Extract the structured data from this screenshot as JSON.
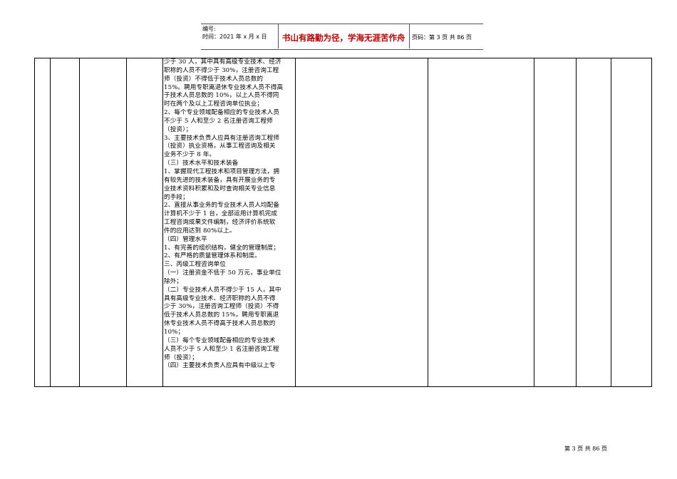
{
  "header": {
    "serial_label": "编号:",
    "time_label": "时间：2021 年 x 月 x 日",
    "motto": "书山有路勤为径，学海无涯苦作舟",
    "page_label": "页码：第 3 页  共 86 页"
  },
  "content_lines": [
    "少于 30 人，其中具有高级专业技术、经济",
    "职称的人员不得少于 30%，注册咨询工程",
    "师（投资）不得低于技术人员总数的",
    "15%。聘用专职离退休专业技术人员不得高",
    "于技术人员总数的 10%，以上人员不得同",
    "时在两个及以上工程咨询单位执业；",
    "2、每个专业领域配备相应的专业技术人员",
    "不少于 5 人和至少 2 名注册咨询工程师",
    "（投资）；",
    "3、主要技术负责人应具有注册咨询工程师",
    "（投资）执业资格，从事工程咨询及相关",
    "业务不少于 8 年。",
    "（三）技术水平和技术装备",
    "1、掌握现代工程技术和项目管理方法，拥",
    "有较先进的技术装备，具有开展业务的专",
    "业技术资料积累和及时查询相关专业信息",
    "的手段；",
    "2、直接从事业务的专业技术人员人均配备",
    "计算机不少于 1 台，全部运用计算机完成",
    "工程咨询成果文件编制，经济评价系统软",
    "件的应用达到 80%以上。",
    "（四）管理水平",
    "1、有完善的组织结构，健全的管理制度；",
    "2、有严格的质量管理体系和制度。",
    "三、丙级工程咨询单位",
    "（一）注册资金不低于 50 万元，事业单位",
    "除外；",
    "（二）专业技术人员不得少于 15 人，其中",
    "具有高级专业技术、经济职称的人员不得",
    "少于 30%，注册咨询工程师（投资）不得",
    "低于技术人员总数的 15%，聘用专职离退",
    "休专业技术人员不得高于技术人员总数的",
    "10%；",
    "（三）每个专业领域配备相应的专业技术",
    "人员不少于 5 人和至少 1 名注册咨询工程",
    "师（投资）；",
    "（四）主要技术负责人应具有中级以上专"
  ],
  "footer": {
    "page_text": "第 3 页  共 86 页"
  }
}
